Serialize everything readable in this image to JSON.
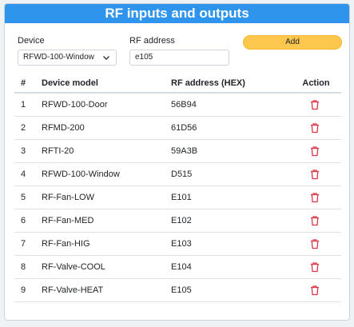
{
  "header": {
    "title": "RF inputs and outputs"
  },
  "form": {
    "device_label": "Device",
    "device_value": "RFWD-100-Window",
    "address_label": "RF address",
    "address_value": "e105",
    "add_label": "Add"
  },
  "table": {
    "columns": [
      "#",
      "Device model",
      "RF address (HEX)",
      "Action"
    ],
    "rows": [
      {
        "num": "1",
        "model": "RFWD-100-Door",
        "address": "56B94"
      },
      {
        "num": "2",
        "model": "RFMD-200",
        "address": "61D56"
      },
      {
        "num": "3",
        "model": "RFTI-20",
        "address": "59A3B"
      },
      {
        "num": "4",
        "model": "RFWD-100-Window",
        "address": "D515"
      },
      {
        "num": "5",
        "model": "RF-Fan-LOW",
        "address": "E101"
      },
      {
        "num": "6",
        "model": "RF-Fan-MED",
        "address": "E102"
      },
      {
        "num": "7",
        "model": "RF-Fan-HIG",
        "address": "E103"
      },
      {
        "num": "8",
        "model": "RF-Valve-COOL",
        "address": "E104"
      },
      {
        "num": "9",
        "model": "RF-Valve-HEAT",
        "address": "E105"
      }
    ]
  },
  "colors": {
    "header_bg": "#2f95ec",
    "add_button": "#fdc74d",
    "delete_icon": "#dc3545"
  },
  "icons": {
    "select_arrow": "chevron-down-icon",
    "delete": "trash-icon"
  }
}
